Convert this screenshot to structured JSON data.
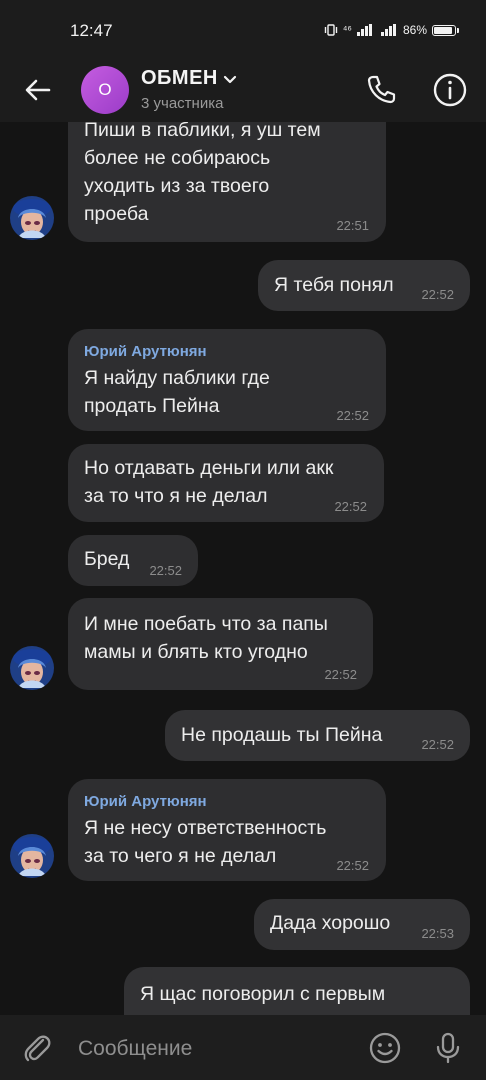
{
  "status_bar": {
    "time": "12:47",
    "network": "⁴⁶",
    "battery": "86%"
  },
  "header": {
    "avatar_letter": "О",
    "title": "ОБМЕН",
    "subtitle": "3 участника",
    "icons": [
      "back-arrow-icon",
      "chevron-down-icon",
      "phone-icon",
      "info-icon"
    ]
  },
  "messages": [
    {
      "direction": "in",
      "author": "",
      "text": "Пиши в паблики, я уш тем\nболее не собираюсь\nуходить из за твоего\nпроеба",
      "time": "22:51",
      "avatar": true
    },
    {
      "direction": "out",
      "author": "",
      "text": "Я тебя понял",
      "time": "22:52",
      "avatar": false
    },
    {
      "direction": "in",
      "author": "Юрий Арутюнян",
      "text": "Я найду паблики где\nпродать Пейна",
      "time": "22:52",
      "avatar": false
    },
    {
      "direction": "in",
      "author": "",
      "text": "Но отдавать деньги или акк\nза то что я не делал",
      "time": "22:52",
      "avatar": false
    },
    {
      "direction": "in",
      "author": "",
      "text": "Бред",
      "time": "22:52",
      "avatar": false
    },
    {
      "direction": "in",
      "author": "",
      "text": "И мне поебать что за папы\nмамы и блять кто угодно",
      "time": "22:52",
      "avatar": true
    },
    {
      "direction": "out",
      "author": "",
      "text": "Не продашь ты Пейна",
      "time": "22:52",
      "avatar": false
    },
    {
      "direction": "in",
      "author": "Юрий Арутюнян",
      "text": "Я не несу ответственность\nза то чего я не делал",
      "time": "22:52",
      "avatar": true
    },
    {
      "direction": "out",
      "author": "",
      "text": "Дада хорошо",
      "time": "22:53",
      "avatar": false
    },
    {
      "direction": "out",
      "author": "",
      "text": "Я щас поговорил с первым",
      "time": "",
      "avatar": false
    }
  ],
  "composer": {
    "placeholder": "Сообщение",
    "icons": [
      "paperclip-icon",
      "emoji-icon",
      "microphone-icon"
    ]
  },
  "colors": {
    "background": "#141414",
    "bubble": "#2e2e30",
    "author": "#7fa9e0",
    "group_avatar": "#b84fd8"
  }
}
